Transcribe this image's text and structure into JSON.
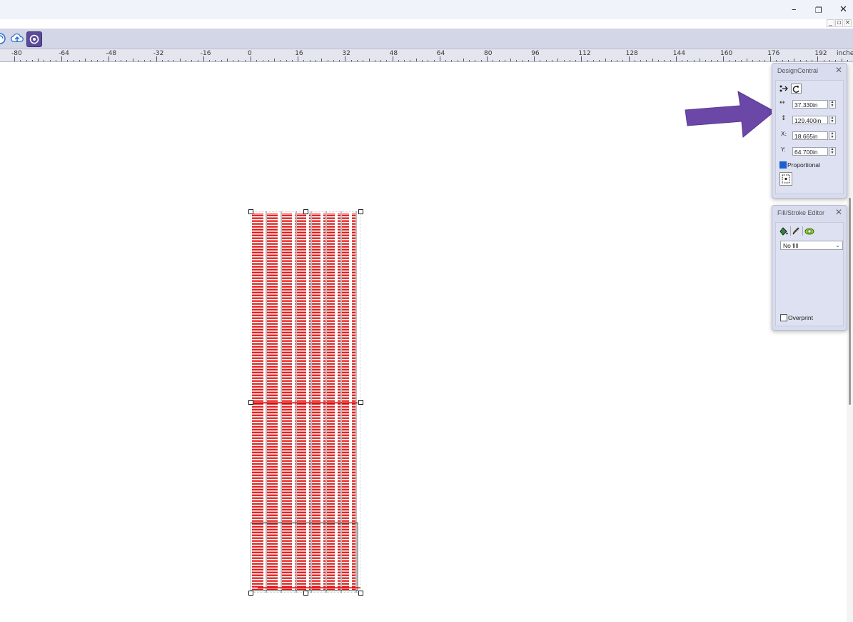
{
  "window": {
    "controls": {
      "minimize": "–",
      "restore": "❐",
      "close": "✕"
    },
    "mdi_controls": {
      "minimize": "_",
      "restore": "▫",
      "close": "×"
    }
  },
  "toolbar": {
    "icons": [
      "cloud-sync-icon",
      "cloud-upload-icon",
      "design-icon"
    ]
  },
  "ruler": {
    "labels": [
      "-80",
      "-64",
      "-48",
      "-32",
      "-16",
      "0",
      "16",
      "32",
      "48",
      "64",
      "80",
      "96",
      "112",
      "128",
      "144",
      "160",
      "176",
      "192"
    ],
    "unit": "inches"
  },
  "design_central": {
    "title": "DesignCentral",
    "close": "✕",
    "width": {
      "icon": "↔",
      "value": "37.330in"
    },
    "height": {
      "icon": "↕",
      "value": "129.400in"
    },
    "x": {
      "label": "X:",
      "value": "18.665in"
    },
    "y": {
      "label": "Y:",
      "value": "64.700in"
    },
    "proportional": {
      "label": "Proportional",
      "checked": true
    }
  },
  "fill_stroke": {
    "title": "Fill/Stroke Editor",
    "close": "✕",
    "fill_select": "No fill",
    "overprint": {
      "label": "Overprint",
      "checked": false
    }
  },
  "colors": {
    "design_red": "#e01010",
    "arrow_purple": "#6b47a8"
  }
}
